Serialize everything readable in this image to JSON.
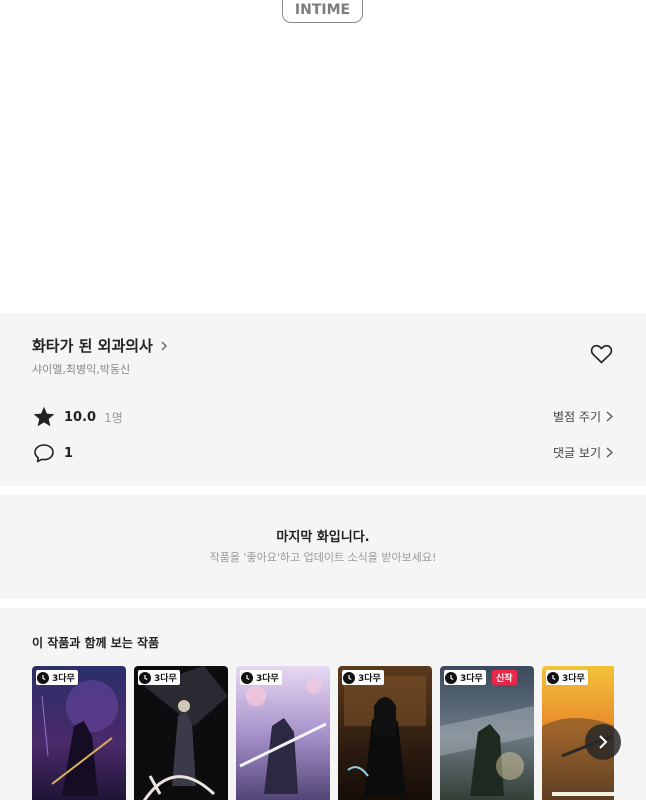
{
  "header": {
    "logo_text": "INTIME"
  },
  "episode": {
    "title": "화타가 된 외과의사",
    "authors": "샤이멜,최병익,박동신",
    "rating": {
      "value": "10.0",
      "count": "1명",
      "action_label": "별점 주기"
    },
    "comments": {
      "count": "1",
      "action_label": "댓글 보기"
    }
  },
  "last_notice": {
    "title": "마지막 화입니다.",
    "subtitle": "작품을 '좋아요'하고 업데이트 소식을 받아보세요!"
  },
  "recommend": {
    "title": "이 작품과 함께 보는 작품",
    "badge_label": "3다무",
    "new_label": "신작",
    "items": [
      {
        "badge": "3다무"
      },
      {
        "badge": "3다무"
      },
      {
        "badge": "3다무"
      },
      {
        "badge": "3다무"
      },
      {
        "badge": "3다무",
        "new": "신작"
      },
      {
        "badge": "3다무"
      }
    ]
  },
  "colors": {
    "panel_bg": "#f5f5f5",
    "badge_new": "#e7284b",
    "text_main": "#222222",
    "text_muted": "#888888"
  },
  "icons": [
    "heart-icon",
    "star-icon",
    "comment-icon",
    "chevron-right-icon",
    "clock-icon",
    "next-arrow-icon"
  ]
}
